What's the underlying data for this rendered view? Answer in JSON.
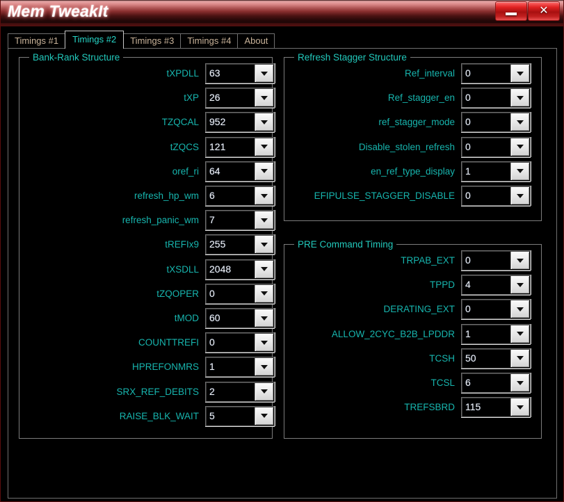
{
  "window": {
    "title": "Mem TweakIt",
    "minimize_label": "_",
    "close_label": "✕"
  },
  "tabs": [
    {
      "label": "Timings #1",
      "active": false
    },
    {
      "label": "Timings #2",
      "active": true
    },
    {
      "label": "Timings #3",
      "active": false
    },
    {
      "label": "Timings #4",
      "active": false
    },
    {
      "label": "About",
      "active": false
    }
  ],
  "groups": {
    "bank_rank": {
      "title": "Bank-Rank Structure",
      "rows": [
        {
          "label": "tXPDLL",
          "value": "63"
        },
        {
          "label": "tXP",
          "value": "26"
        },
        {
          "label": "TZQCAL",
          "value": "952"
        },
        {
          "label": "tZQCS",
          "value": "121"
        },
        {
          "label": "oref_ri",
          "value": "64"
        },
        {
          "label": "refresh_hp_wm",
          "value": "6"
        },
        {
          "label": "refresh_panic_wm",
          "value": "7"
        },
        {
          "label": "tREFIx9",
          "value": "255"
        },
        {
          "label": "tXSDLL",
          "value": "2048"
        },
        {
          "label": "tZQOPER",
          "value": "0"
        },
        {
          "label": "tMOD",
          "value": "60"
        },
        {
          "label": "COUNTTREFI",
          "value": "0"
        },
        {
          "label": "HPREFONMRS",
          "value": "1"
        },
        {
          "label": "SRX_REF_DEBITS",
          "value": "2"
        },
        {
          "label": "RAISE_BLK_WAIT",
          "value": "5"
        }
      ]
    },
    "refresh_stagger": {
      "title": "Refresh Stagger Structure",
      "rows": [
        {
          "label": "Ref_interval",
          "value": "0"
        },
        {
          "label": "Ref_stagger_en",
          "value": "0"
        },
        {
          "label": "ref_stagger_mode",
          "value": "0"
        },
        {
          "label": "Disable_stolen_refresh",
          "value": "0"
        },
        {
          "label": "en_ref_type_display",
          "value": "1"
        },
        {
          "label": "EFIPULSE_STAGGER_DISABLE",
          "value": "0"
        }
      ]
    },
    "pre_command": {
      "title": "PRE Command Timing",
      "rows": [
        {
          "label": "TRPAB_EXT",
          "value": "0"
        },
        {
          "label": "TPPD",
          "value": "4"
        },
        {
          "label": "DERATING_EXT",
          "value": "0"
        },
        {
          "label": "ALLOW_2CYC_B2B_LPDDR",
          "value": "1"
        },
        {
          "label": "TCSH",
          "value": "50"
        },
        {
          "label": "TCSL",
          "value": "6"
        },
        {
          "label": "TREFSBRD",
          "value": "115"
        }
      ]
    }
  },
  "colors": {
    "label_cyan": "#17b5ae",
    "group_title_cyan": "#22c8bb",
    "active_tab_text": "#27d6c8",
    "inactive_tab_text": "#c9b39a",
    "titlebar_red": "#a81010",
    "background": "#000000"
  }
}
